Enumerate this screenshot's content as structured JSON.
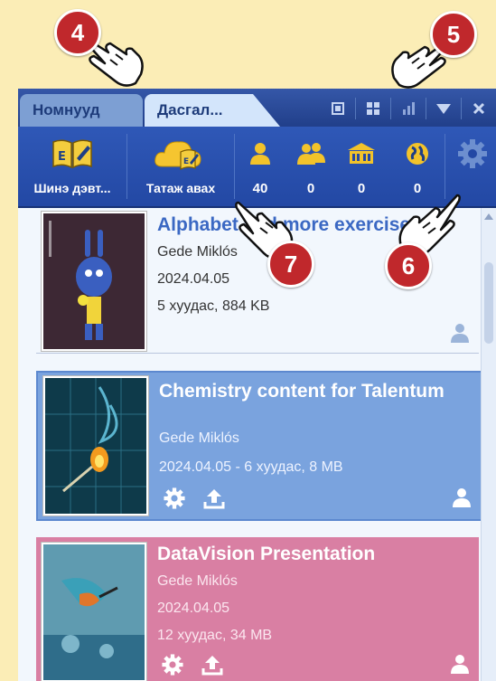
{
  "window": {
    "tabs": [
      {
        "label": "Номнууд"
      },
      {
        "label": "Дасгал..."
      }
    ]
  },
  "toolbar": {
    "buttons": [
      {
        "label": "Шинэ дэвт..."
      },
      {
        "label": "Татаж авах"
      }
    ],
    "counters": [
      {
        "icon": "single-user-icon",
        "value": "40"
      },
      {
        "icon": "group-users-icon",
        "value": "0"
      },
      {
        "icon": "school-icon",
        "value": "0"
      },
      {
        "icon": "globe-icon",
        "value": "0"
      }
    ]
  },
  "items": [
    {
      "title": "Alphabet and more exercises",
      "author": "Gede Miklós",
      "date": "2024.04.05",
      "info": "5 хуудас, 884 KB"
    },
    {
      "title": "Chemistry content for Talentum",
      "author": "Gede Miklós",
      "info": "2024.04.05 - 6 хуудас, 8 MB"
    },
    {
      "title": "DataVision Presentation",
      "author": "Gede Miklós",
      "date": "2024.04.05",
      "info": "12 хуудас, 34 MB"
    }
  ],
  "callouts": [
    "4",
    "5",
    "6",
    "7"
  ],
  "colors": {
    "accent": "#2348a4",
    "badge": "#c0282c",
    "item_selected": "#7aa3de",
    "item_pink": "#d97fa3"
  }
}
